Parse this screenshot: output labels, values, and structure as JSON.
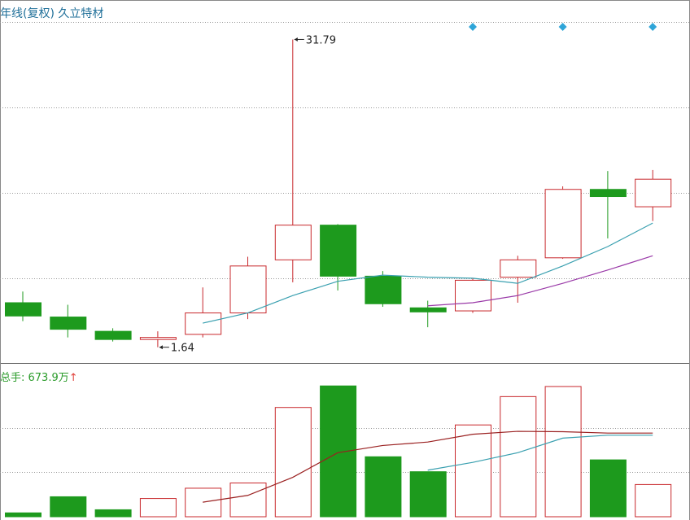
{
  "header": {
    "title": "年线(复权) 久立特材"
  },
  "volume_header": {
    "label": "总手: ",
    "value": "673.9万",
    "arrow": "↑"
  },
  "colors": {
    "up": "#c8282c",
    "down": "#1d9a1d",
    "ma_short": "#3aa0b0",
    "ma_long": "#9a3aa8",
    "vol_ma1": "#9a2020",
    "vol_ma2": "#3aa0b0",
    "marker": "#2fa5d8",
    "grid": "#999999"
  },
  "chart_data": [
    {
      "type": "candlestick",
      "title": "年线(复权) 久立特材",
      "y_range": [
        0.5,
        33.5
      ],
      "candles": [
        {
          "open": 6.0,
          "close": 4.7,
          "high": 7.1,
          "low": 4.2
        },
        {
          "open": 4.6,
          "close": 3.4,
          "high": 5.8,
          "low": 2.6
        },
        {
          "open": 3.2,
          "close": 2.4,
          "high": 3.5,
          "low": 2.2
        },
        {
          "open": 2.4,
          "close": 2.6,
          "high": 3.2,
          "low": 1.64
        },
        {
          "open": 2.9,
          "close": 5.0,
          "high": 7.5,
          "low": 2.6
        },
        {
          "open": 5.0,
          "close": 9.6,
          "high": 10.5,
          "low": 4.4
        },
        {
          "open": 10.2,
          "close": 13.6,
          "high": 31.79,
          "low": 8.0
        },
        {
          "open": 13.6,
          "close": 8.6,
          "high": 13.7,
          "low": 7.2
        },
        {
          "open": 8.6,
          "close": 5.9,
          "high": 9.1,
          "low": 5.6
        },
        {
          "open": 5.5,
          "close": 5.1,
          "high": 6.2,
          "low": 3.6
        },
        {
          "open": 5.2,
          "close": 8.2,
          "high": 8.4,
          "low": 5.0
        },
        {
          "open": 8.5,
          "close": 10.2,
          "high": 10.6,
          "low": 6.0
        },
        {
          "open": 10.4,
          "close": 17.1,
          "high": 17.4,
          "low": 10.3
        },
        {
          "open": 17.1,
          "close": 16.4,
          "high": 18.9,
          "low": 12.3
        },
        {
          "open": 15.4,
          "close": 18.1,
          "high": 19.0,
          "low": 14.0
        }
      ],
      "ma_short": [
        null,
        null,
        null,
        null,
        4.0,
        5.0,
        6.7,
        8.1,
        8.7,
        8.5,
        8.4,
        7.9,
        9.6,
        11.5,
        13.8
      ],
      "ma_long": [
        null,
        null,
        null,
        null,
        null,
        null,
        null,
        null,
        null,
        5.7,
        6.0,
        6.7,
        7.9,
        9.2,
        10.6
      ],
      "annotations": [
        {
          "index": 6,
          "value": 31.79,
          "text": "31.79"
        },
        {
          "index": 3,
          "value": 1.64,
          "text": "1.64"
        }
      ],
      "markers": [
        10,
        12,
        14
      ]
    },
    {
      "type": "bar",
      "title": "总手: 673.9万",
      "y_range": [
        0,
        675
      ],
      "bar_direction": [
        "down",
        "down",
        "down",
        "up",
        "up",
        "up",
        "up",
        "down",
        "down",
        "down",
        "up",
        "up",
        "up",
        "down",
        "up"
      ],
      "values": [
        20,
        103,
        36,
        94,
        147,
        174,
        563,
        674,
        309,
        232,
        473,
        619,
        671,
        293,
        166
      ],
      "ma1": [
        null,
        null,
        null,
        null,
        75,
        110,
        203,
        330,
        367,
        385,
        425,
        440,
        438,
        431,
        431
      ],
      "ma2": [
        null,
        null,
        null,
        null,
        null,
        null,
        null,
        null,
        null,
        240,
        280,
        330,
        405,
        420,
        420
      ]
    }
  ]
}
